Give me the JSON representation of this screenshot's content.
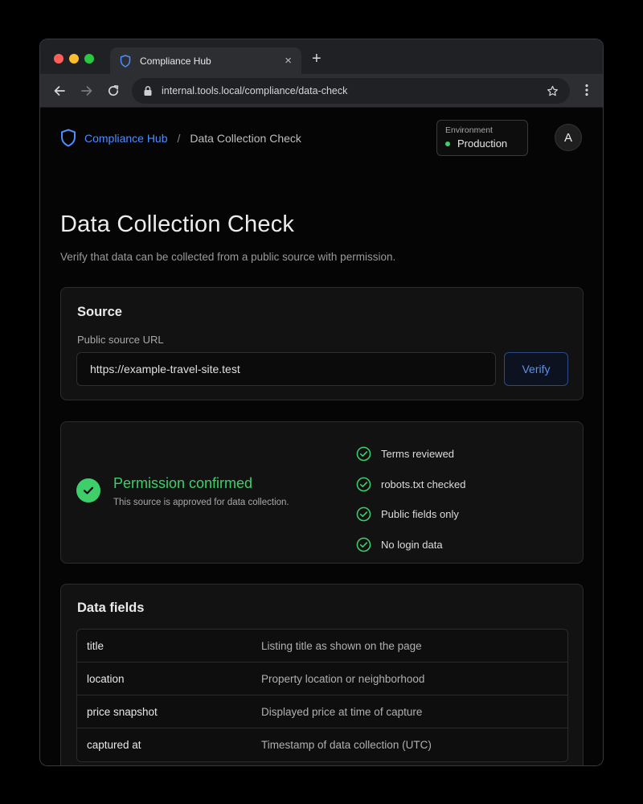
{
  "browser": {
    "tab_title": "Compliance Hub",
    "tab_close": "×",
    "new_tab": "+",
    "url": "internal.tools.local/compliance/data-check"
  },
  "breadcrumb": {
    "home": "Compliance Hub",
    "separator": "/",
    "current": "Data Collection Check"
  },
  "environment": {
    "label": "Environment",
    "value": "Production",
    "status_color": "#3ecf6a"
  },
  "user": {
    "avatar_initial": "A"
  },
  "page": {
    "title": "Data Collection Check",
    "subtitle": "Verify that data can be collected from a public source with permission."
  },
  "source": {
    "heading": "Source",
    "field_label": "Public source URL",
    "url_value": "https://example-travel-site.test",
    "verify_label": "Verify"
  },
  "permission": {
    "title": "Permission confirmed",
    "subtitle": "This source is approved for data collection.",
    "checks": [
      {
        "label": "Terms reviewed"
      },
      {
        "label": "robots.txt checked"
      },
      {
        "label": "Public fields only"
      },
      {
        "label": "No login data"
      }
    ]
  },
  "data_fields": {
    "heading": "Data fields",
    "rows": [
      {
        "name": "title",
        "description": "Listing title as shown on the page"
      },
      {
        "name": "location",
        "description": "Property location or neighborhood"
      },
      {
        "name": "price snapshot",
        "description": "Displayed price at time of capture"
      },
      {
        "name": "captured at",
        "description": "Timestamp of data collection (UTC)"
      }
    ]
  },
  "colors": {
    "accent_blue": "#4c8dff",
    "success_green": "#3ecf6a"
  },
  "icons": [
    "shield-icon",
    "back-icon",
    "forward-icon",
    "reload-icon",
    "lock-icon",
    "star-icon",
    "more-icon",
    "check-circle-icon"
  ]
}
